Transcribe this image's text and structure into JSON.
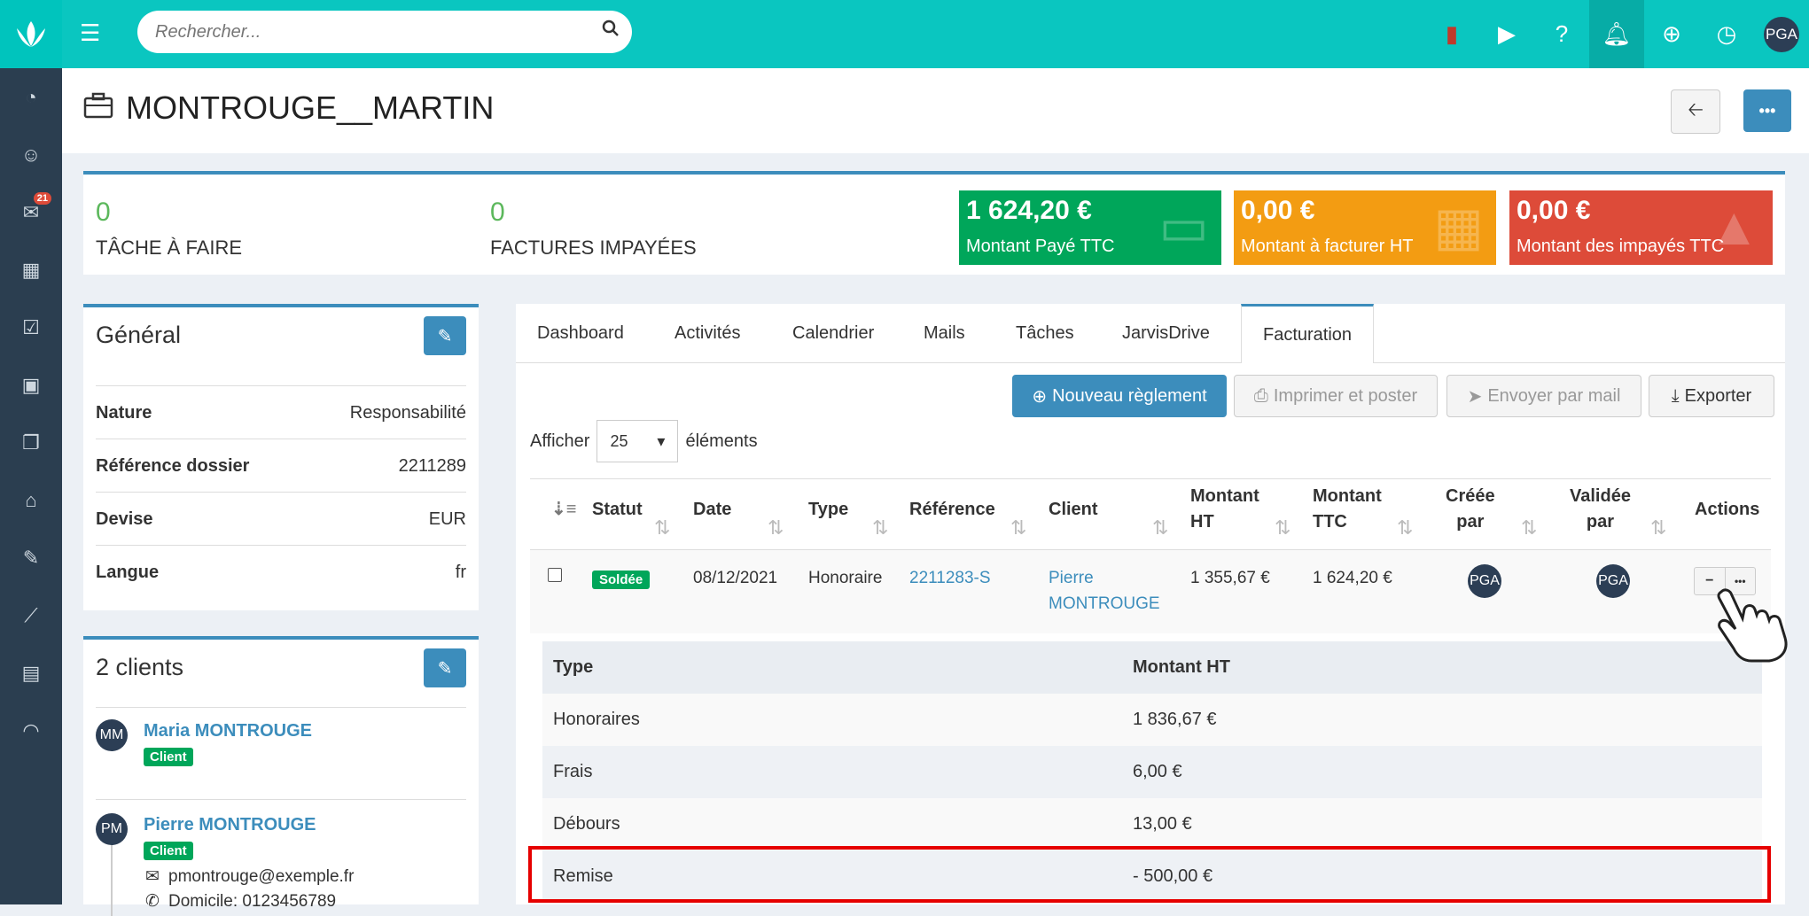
{
  "topbar": {
    "search_placeholder": "Rechercher...",
    "avatar_initials": "PGA"
  },
  "sidebar": {
    "mail_badge": "21"
  },
  "page": {
    "title": "MONTROUGE__MARTIN"
  },
  "stats": {
    "tasks_count": "0",
    "tasks_label": "TÂCHE À FAIRE",
    "unpaid_count": "0",
    "unpaid_label": "FACTURES IMPAYÉES",
    "tiles": [
      {
        "amount": "1 624,20 €",
        "label": "Montant Payé TTC",
        "color": "#00a65a"
      },
      {
        "amount": "0,00 €",
        "label": "Montant à facturer HT",
        "color": "#f39c12"
      },
      {
        "amount": "0,00 €",
        "label": "Montant des impayés TTC",
        "color": "#dd4b39"
      }
    ]
  },
  "general": {
    "title": "Général",
    "rows": [
      {
        "key": "Nature",
        "value": "Responsabilité"
      },
      {
        "key": "Référence dossier",
        "value": "2211289"
      },
      {
        "key": "Devise",
        "value": "EUR"
      },
      {
        "key": "Langue",
        "value": "fr"
      }
    ]
  },
  "clients": {
    "title": "2 clients",
    "items": [
      {
        "initials": "MM",
        "name": "Maria MONTROUGE",
        "badge": "Client"
      },
      {
        "initials": "PM",
        "name": "Pierre MONTROUGE",
        "badge": "Client",
        "email": "pmontrouge@exemple.fr",
        "phone": "Domicile: 0123456789"
      }
    ]
  },
  "tabs": [
    "Dashboard",
    "Activités",
    "Calendrier",
    "Mails",
    "Tâches",
    "JarvisDrive",
    "Facturation"
  ],
  "actions": {
    "new_payment": "Nouveau règlement",
    "print": "Imprimer et poster",
    "send_mail": "Envoyer par mail",
    "export": "Exporter"
  },
  "paging": {
    "show": "Afficher",
    "value": "25",
    "elements": "éléments"
  },
  "table": {
    "headers": {
      "status": "Statut",
      "date": "Date",
      "type": "Type",
      "reference": "Référence",
      "client": "Client",
      "ht_1": "Montant",
      "ht_2": "HT",
      "ttc_1": "Montant",
      "ttc_2": "TTC",
      "created_1": "Créée",
      "created_2": "par",
      "validated_1": "Validée",
      "validated_2": "par",
      "actions": "Actions"
    },
    "row": {
      "status": "Soldée",
      "date": "08/12/2021",
      "type": "Honoraire",
      "reference": "2211283-S",
      "client_1": "Pierre",
      "client_2": "MONTROUGE",
      "ht": "1 355,67 €",
      "ttc": "1 624,20 €",
      "created_by": "PGA",
      "validated_by": "PGA"
    }
  },
  "detail": {
    "col_type": "Type",
    "col_amount": "Montant HT",
    "rows": [
      {
        "type": "Honoraires",
        "amount": "1 836,67 €"
      },
      {
        "type": "Frais",
        "amount": "6,00 €"
      },
      {
        "type": "Débours",
        "amount": "13,00 €"
      },
      {
        "type": "Remise",
        "amount": "- 500,00 €"
      }
    ]
  }
}
